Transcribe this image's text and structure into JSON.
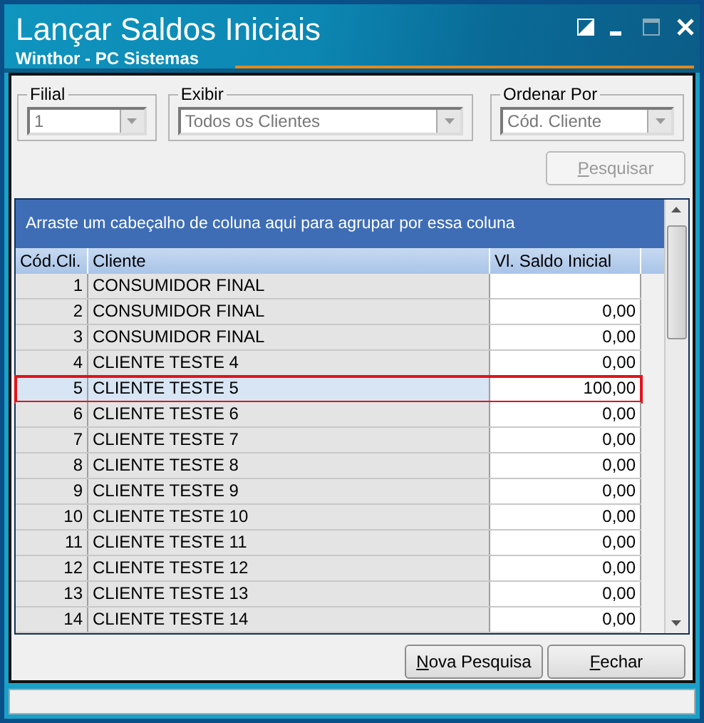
{
  "window": {
    "title": "Lançar Saldos Iniciais",
    "subtitle": "Winthor - PC Sistemas"
  },
  "filters": [
    {
      "label": "Filial",
      "value": "1",
      "disabled": true
    },
    {
      "label": "Exibir",
      "value": "Todos os Clientes",
      "disabled": true
    },
    {
      "label": "Ordenar Por",
      "value": "Cód. Cliente",
      "disabled": true
    }
  ],
  "search_button": {
    "label": "Pesquisar",
    "disabled": true
  },
  "grid": {
    "group_hint": "Arraste um cabeçalho de coluna aqui para agrupar por essa coluna",
    "columns": [
      "Cód.Cli.",
      "Cliente",
      "Vl. Saldo Inicial"
    ],
    "rows": [
      {
        "code": "1",
        "client": "CONSUMIDOR FINAL",
        "selected": false
      },
      {
        "code": "2",
        "client": "CONSUMIDOR FINAL",
        "value": "0,00",
        "selected": false
      },
      {
        "code": "3",
        "client": "CONSUMIDOR FINAL",
        "value": "0,00",
        "selected": false
      },
      {
        "code": "4",
        "client": "CLIENTE TESTE 4",
        "value": "0,00",
        "selected": false
      },
      {
        "code": "5",
        "client": "CLIENTE TESTE 5",
        "value": "100,00",
        "selected": true
      },
      {
        "code": "6",
        "client": "CLIENTE TESTE 6",
        "value": "0,00",
        "selected": false
      },
      {
        "code": "7",
        "client": "CLIENTE TESTE 7",
        "value": "0,00",
        "selected": false
      },
      {
        "code": "8",
        "client": "CLIENTE TESTE 8",
        "value": "0,00",
        "selected": false
      },
      {
        "code": "9",
        "client": "CLIENTE TESTE 9",
        "value": "0,00",
        "selected": false
      },
      {
        "code": "10",
        "client": "CLIENTE TESTE 10",
        "value": "0,00",
        "selected": false
      },
      {
        "code": "11",
        "client": "CLIENTE TESTE 11",
        "value": "0,00",
        "selected": false
      },
      {
        "code": "12",
        "client": "CLIENTE TESTE 12",
        "value": "0,00",
        "selected": false
      },
      {
        "code": "13",
        "client": "CLIENTE TESTE 13",
        "value": "0,00",
        "selected": false
      },
      {
        "code": "14",
        "client": "CLIENTE TESTE 14",
        "value": "0,00",
        "selected": false
      }
    ]
  },
  "buttons": [
    "Nova Pesquisa",
    "Fechar"
  ]
}
